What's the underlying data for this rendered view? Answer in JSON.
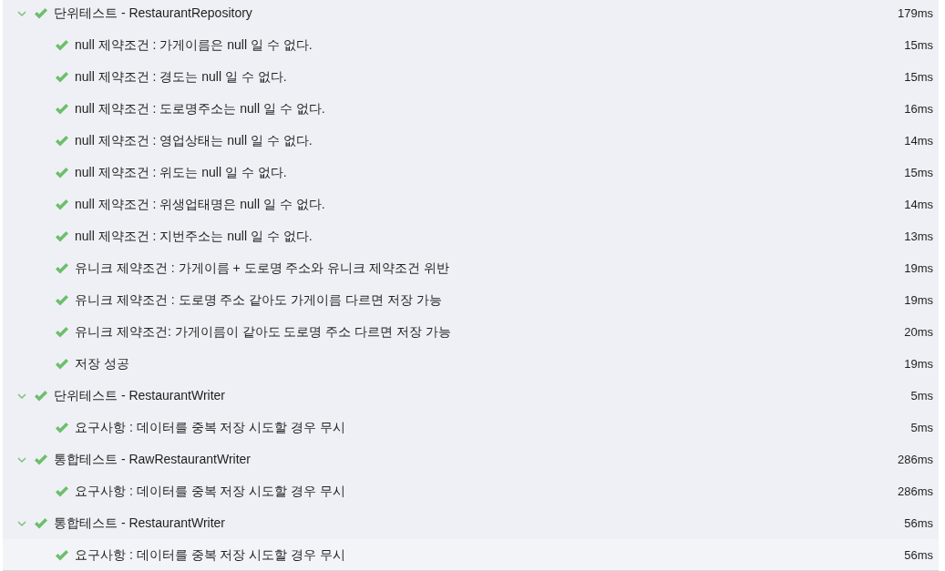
{
  "tests": [
    {
      "label": "단위테스트 - RestaurantRepository",
      "time": "179ms",
      "passed": true,
      "expanded": true,
      "children": [
        {
          "label": "null 제약조건 : 가게이름은 null 일 수 없다.",
          "time": "15ms",
          "passed": true
        },
        {
          "label": "null 제약조건 : 경도는 null 일 수 없다.",
          "time": "15ms",
          "passed": true
        },
        {
          "label": "null 제약조건 : 도로명주소는 null 일 수 없다.",
          "time": "16ms",
          "passed": true
        },
        {
          "label": "null 제약조건 : 영업상태는 null 일 수 없다.",
          "time": "14ms",
          "passed": true
        },
        {
          "label": "null 제약조건 : 위도는 null 일 수 없다.",
          "time": "15ms",
          "passed": true
        },
        {
          "label": "null 제약조건 : 위생업태명은 null 일 수 없다.",
          "time": "14ms",
          "passed": true
        },
        {
          "label": "null 제약조건 : 지번주소는 null 일 수 없다.",
          "time": "13ms",
          "passed": true
        },
        {
          "label": "유니크 제약조건 : 가게이름 + 도로명 주소와 유니크 제약조건 위반",
          "time": "19ms",
          "passed": true
        },
        {
          "label": "유니크 제약조건 : 도로명 주소 같아도 가게이름 다르면 저장 가능",
          "time": "19ms",
          "passed": true
        },
        {
          "label": "유니크 제약조건: 가게이름이 같아도 도로명 주소 다르면 저장 가능",
          "time": "20ms",
          "passed": true
        },
        {
          "label": "저장 성공",
          "time": "19ms",
          "passed": true
        }
      ]
    },
    {
      "label": "단위테스트 - RestaurantWriter",
      "time": "5ms",
      "passed": true,
      "expanded": true,
      "children": [
        {
          "label": "요구사항 : 데이터를 중복 저장 시도할 경우 무시",
          "time": "5ms",
          "passed": true
        }
      ]
    },
    {
      "label": "통합테스트 - RawRestaurantWriter",
      "time": "286ms",
      "passed": true,
      "expanded": true,
      "children": [
        {
          "label": "요구사항 : 데이터를 중복 저장 시도할 경우 무시",
          "time": "286ms",
          "passed": true
        }
      ]
    },
    {
      "label": "통합테스트 - RestaurantWriter",
      "time": "56ms",
      "passed": true,
      "expanded": true,
      "children": [
        {
          "label": "요구사항 : 데이터를 중복 저장 시도할 경우 무시",
          "time": "56ms",
          "passed": true,
          "selected": true
        }
      ]
    }
  ]
}
